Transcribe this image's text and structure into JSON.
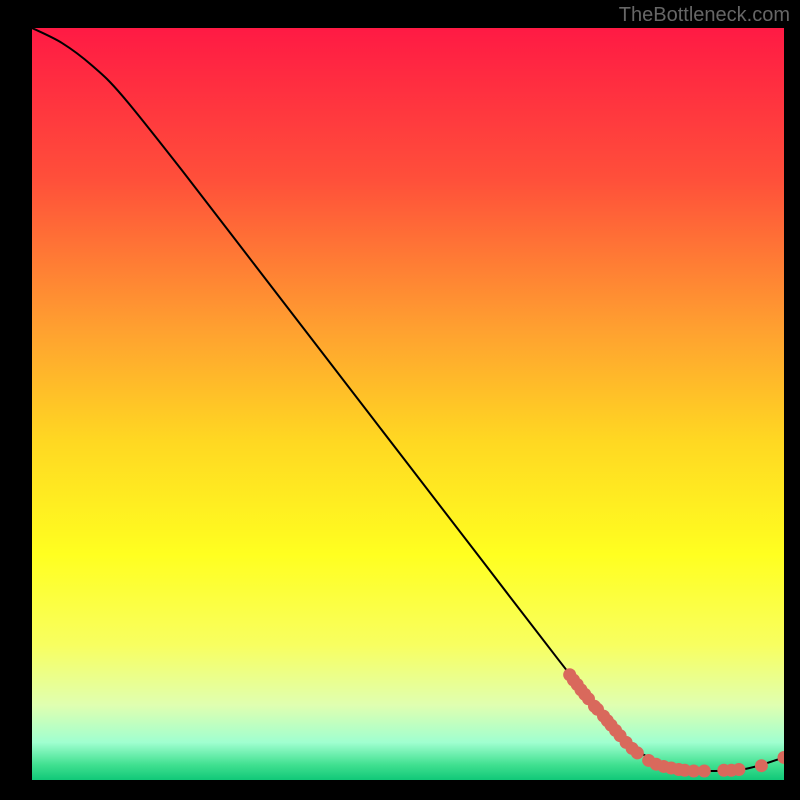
{
  "watermark": "TheBottleneck.com",
  "chart_data": {
    "type": "line",
    "title": "",
    "xlabel": "",
    "ylabel": "",
    "xlim": [
      0,
      100
    ],
    "ylim": [
      0,
      100
    ],
    "curve": [
      {
        "x": 0,
        "y": 100
      },
      {
        "x": 4,
        "y": 98
      },
      {
        "x": 8,
        "y": 95
      },
      {
        "x": 12,
        "y": 91
      },
      {
        "x": 20,
        "y": 81
      },
      {
        "x": 30,
        "y": 68
      },
      {
        "x": 40,
        "y": 55
      },
      {
        "x": 50,
        "y": 42
      },
      {
        "x": 60,
        "y": 29
      },
      {
        "x": 70,
        "y": 16
      },
      {
        "x": 78,
        "y": 6
      },
      {
        "x": 82,
        "y": 3
      },
      {
        "x": 86,
        "y": 1.5
      },
      {
        "x": 90,
        "y": 1.2
      },
      {
        "x": 95,
        "y": 1.5
      },
      {
        "x": 100,
        "y": 3
      }
    ],
    "markers": [
      {
        "x": 71.5,
        "y": 14.0
      },
      {
        "x": 72.0,
        "y": 13.3
      },
      {
        "x": 72.5,
        "y": 12.7
      },
      {
        "x": 73.0,
        "y": 12.0
      },
      {
        "x": 73.5,
        "y": 11.4
      },
      {
        "x": 74.0,
        "y": 10.8
      },
      {
        "x": 74.8,
        "y": 9.8
      },
      {
        "x": 75.2,
        "y": 9.4
      },
      {
        "x": 76.0,
        "y": 8.5
      },
      {
        "x": 76.5,
        "y": 7.9
      },
      {
        "x": 77.0,
        "y": 7.3
      },
      {
        "x": 77.6,
        "y": 6.6
      },
      {
        "x": 78.2,
        "y": 5.9
      },
      {
        "x": 79.0,
        "y": 5.0
      },
      {
        "x": 79.8,
        "y": 4.2
      },
      {
        "x": 80.5,
        "y": 3.6
      },
      {
        "x": 82.0,
        "y": 2.6
      },
      {
        "x": 83.0,
        "y": 2.1
      },
      {
        "x": 84.0,
        "y": 1.8
      },
      {
        "x": 85.0,
        "y": 1.6
      },
      {
        "x": 86.0,
        "y": 1.4
      },
      {
        "x": 86.8,
        "y": 1.3
      },
      {
        "x": 88.0,
        "y": 1.2
      },
      {
        "x": 89.4,
        "y": 1.2
      },
      {
        "x": 92.0,
        "y": 1.3
      },
      {
        "x": 93.0,
        "y": 1.3
      },
      {
        "x": 94.0,
        "y": 1.4
      },
      {
        "x": 97.0,
        "y": 1.9
      },
      {
        "x": 100.0,
        "y": 3.0
      }
    ],
    "gradient_stops": [
      {
        "offset": 0,
        "color": "#ff1a44"
      },
      {
        "offset": 20,
        "color": "#ff4f3a"
      },
      {
        "offset": 40,
        "color": "#ffa030"
      },
      {
        "offset": 55,
        "color": "#ffd822"
      },
      {
        "offset": 70,
        "color": "#ffff20"
      },
      {
        "offset": 82,
        "color": "#f8ff60"
      },
      {
        "offset": 90,
        "color": "#e0ffb0"
      },
      {
        "offset": 95,
        "color": "#a0ffd0"
      },
      {
        "offset": 98,
        "color": "#40e090"
      },
      {
        "offset": 100,
        "color": "#10c878"
      }
    ],
    "marker_color": "#d9695c",
    "curve_color": "#000000"
  }
}
